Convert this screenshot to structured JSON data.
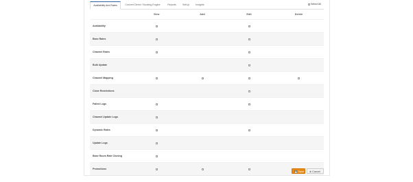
{
  "tabs": [
    {
      "label": "Availability And Rates",
      "active": true
    },
    {
      "label": "Convert Direct / Booking Engine",
      "active": false
    },
    {
      "label": "Reports",
      "active": false
    },
    {
      "label": "SetUp",
      "active": false
    },
    {
      "label": "Insights",
      "active": false
    }
  ],
  "select_all_label": "Select All",
  "columns": [
    "",
    "View",
    "Add",
    "Edit",
    "Delete"
  ],
  "rows": [
    {
      "label": "Availability",
      "view": true,
      "add": false,
      "edit": true,
      "delete": false
    },
    {
      "label": "Base Rates",
      "view": true,
      "add": false,
      "edit": true,
      "delete": false
    },
    {
      "label": "Channel Rates",
      "view": true,
      "add": false,
      "edit": true,
      "delete": false
    },
    {
      "label": "Bulk Update",
      "view": false,
      "add": false,
      "edit": true,
      "delete": false
    },
    {
      "label": "Channel Mapping",
      "view": true,
      "add": true,
      "edit": true,
      "delete": true
    },
    {
      "label": "Close Restrictions",
      "view": false,
      "add": false,
      "edit": true,
      "delete": false
    },
    {
      "label": "Failed Logs",
      "view": true,
      "add": false,
      "edit": true,
      "delete": false
    },
    {
      "label": "Channel Update Logs",
      "view": true,
      "add": false,
      "edit": false,
      "delete": false
    },
    {
      "label": "Dynamic Rates",
      "view": true,
      "add": false,
      "edit": true,
      "delete": false
    },
    {
      "label": "Update Logs",
      "view": true,
      "add": false,
      "edit": false,
      "delete": false
    },
    {
      "label": "Base Room Rate Cloning",
      "view": true,
      "add": false,
      "edit": false,
      "delete": false
    },
    {
      "label": "Promotions",
      "view": true,
      "add": true,
      "edit": true,
      "delete": true
    }
  ],
  "buttons": {
    "save_label": "Save",
    "cancel_label": "Cancel",
    "save_color": "#e98a15"
  },
  "icons": {
    "save": "floppy-disk-icon",
    "cancel": "close-circle-icon"
  }
}
